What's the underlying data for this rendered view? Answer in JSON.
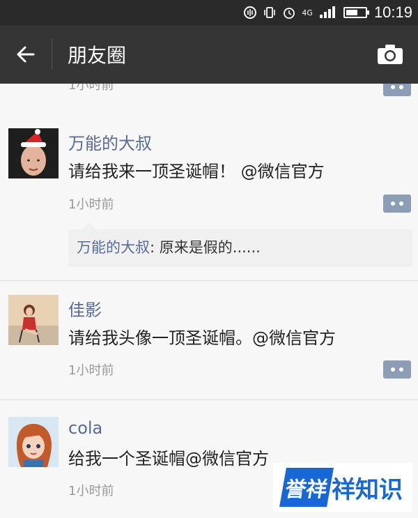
{
  "status_bar": {
    "network": "4G",
    "time": "10:19"
  },
  "nav": {
    "title": "朋友圈"
  },
  "partial_post": {
    "time": "1小时前"
  },
  "posts": [
    {
      "author": "万能的大叔",
      "text": "请给我来一顶圣诞帽！ @微信官方",
      "time": "1小时前",
      "comment": {
        "author": "万能的大叔",
        "separator": ": ",
        "text": "原来是假的......"
      }
    },
    {
      "author": "佳影",
      "text": "请给我头像一顶圣诞帽。@微信官方",
      "time": "1小时前"
    },
    {
      "author": "cola",
      "text": "给我一个圣诞帽@微信官方",
      "time": "1小时前"
    }
  ],
  "watermark": {
    "logo": "誉祥",
    "text": "祥知识"
  },
  "colors": {
    "link_blue": "#576b95",
    "nav_bg": "#353535",
    "status_bg": "#2a2a2a"
  }
}
